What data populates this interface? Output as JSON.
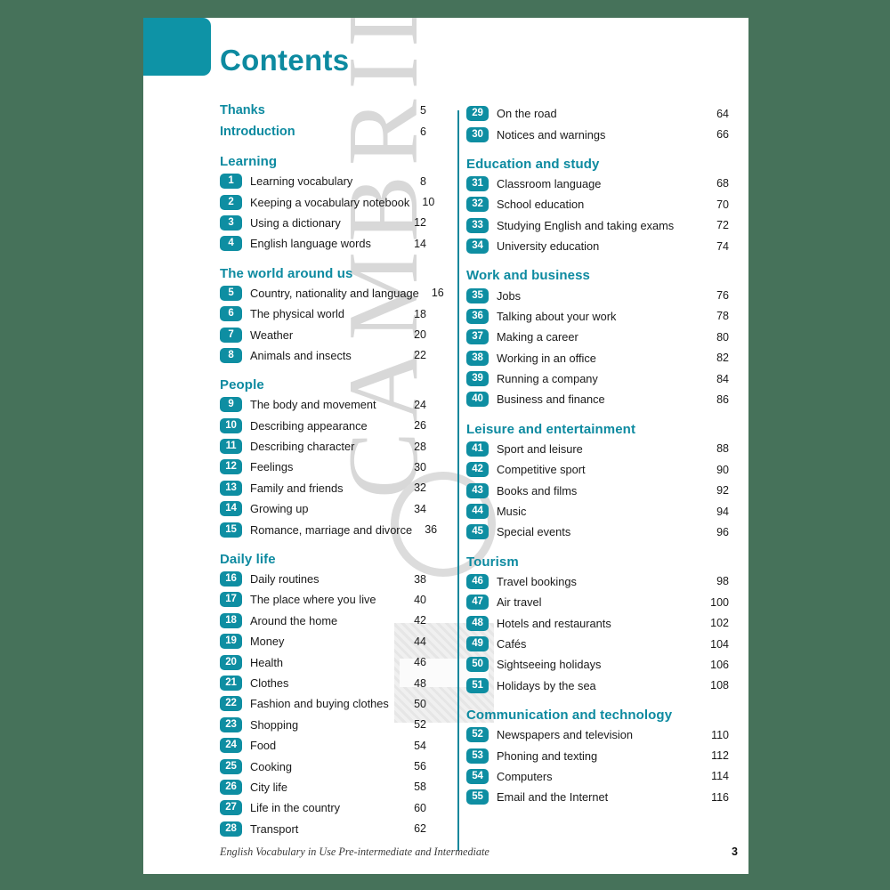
{
  "document": {
    "title": "Contents",
    "accent_color": "#0e93a6",
    "page_background": "#ffffff",
    "canvas_background": "#46725a",
    "watermark_text": "CAMBRIDGE"
  },
  "front_matter": [
    {
      "label": "Thanks",
      "page": "5"
    },
    {
      "label": "Introduction",
      "page": "6"
    }
  ],
  "left_column": [
    {
      "section": "Learning",
      "units": [
        {
          "num": "1",
          "title": "Learning vocabulary",
          "page": "8"
        },
        {
          "num": "2",
          "title": "Keeping a vocabulary notebook",
          "page": "10"
        },
        {
          "num": "3",
          "title": "Using a dictionary",
          "page": "12"
        },
        {
          "num": "4",
          "title": "English language words",
          "page": "14"
        }
      ]
    },
    {
      "section": "The world around us",
      "units": [
        {
          "num": "5",
          "title": "Country, nationality and language",
          "page": "16"
        },
        {
          "num": "6",
          "title": "The physical world",
          "page": "18"
        },
        {
          "num": "7",
          "title": "Weather",
          "page": "20"
        },
        {
          "num": "8",
          "title": "Animals and insects",
          "page": "22"
        }
      ]
    },
    {
      "section": "People",
      "units": [
        {
          "num": "9",
          "title": "The body and movement",
          "page": "24"
        },
        {
          "num": "10",
          "title": "Describing appearance",
          "page": "26"
        },
        {
          "num": "11",
          "title": "Describing character",
          "page": "28"
        },
        {
          "num": "12",
          "title": "Feelings",
          "page": "30"
        },
        {
          "num": "13",
          "title": "Family and friends",
          "page": "32"
        },
        {
          "num": "14",
          "title": "Growing up",
          "page": "34"
        },
        {
          "num": "15",
          "title": "Romance, marriage and divorce",
          "page": "36"
        }
      ]
    },
    {
      "section": "Daily life",
      "units": [
        {
          "num": "16",
          "title": "Daily routines",
          "page": "38"
        },
        {
          "num": "17",
          "title": "The place where you live",
          "page": "40"
        },
        {
          "num": "18",
          "title": "Around the home",
          "page": "42"
        },
        {
          "num": "19",
          "title": "Money",
          "page": "44"
        },
        {
          "num": "20",
          "title": "Health",
          "page": "46"
        },
        {
          "num": "21",
          "title": "Clothes",
          "page": "48"
        },
        {
          "num": "22",
          "title": "Fashion and buying clothes",
          "page": "50"
        },
        {
          "num": "23",
          "title": "Shopping",
          "page": "52"
        },
        {
          "num": "24",
          "title": "Food",
          "page": "54"
        },
        {
          "num": "25",
          "title": "Cooking",
          "page": "56"
        },
        {
          "num": "26",
          "title": "City life",
          "page": "58"
        },
        {
          "num": "27",
          "title": "Life in the country",
          "page": "60"
        },
        {
          "num": "28",
          "title": "Transport",
          "page": "62"
        }
      ]
    }
  ],
  "right_column": [
    {
      "section": "",
      "units": [
        {
          "num": "29",
          "title": "On the road",
          "page": "64"
        },
        {
          "num": "30",
          "title": "Notices and warnings",
          "page": "66"
        }
      ]
    },
    {
      "section": "Education and study",
      "units": [
        {
          "num": "31",
          "title": "Classroom language",
          "page": "68"
        },
        {
          "num": "32",
          "title": "School education",
          "page": "70"
        },
        {
          "num": "33",
          "title": "Studying English and taking exams",
          "page": "72"
        },
        {
          "num": "34",
          "title": "University education",
          "page": "74"
        }
      ]
    },
    {
      "section": "Work and business",
      "units": [
        {
          "num": "35",
          "title": "Jobs",
          "page": "76"
        },
        {
          "num": "36",
          "title": "Talking about your work",
          "page": "78"
        },
        {
          "num": "37",
          "title": "Making a career",
          "page": "80"
        },
        {
          "num": "38",
          "title": "Working in an office",
          "page": "82"
        },
        {
          "num": "39",
          "title": "Running a company",
          "page": "84"
        },
        {
          "num": "40",
          "title": "Business and finance",
          "page": "86"
        }
      ]
    },
    {
      "section": "Leisure and entertainment",
      "units": [
        {
          "num": "41",
          "title": "Sport and leisure",
          "page": "88"
        },
        {
          "num": "42",
          "title": "Competitive sport",
          "page": "90"
        },
        {
          "num": "43",
          "title": "Books and films",
          "page": "92"
        },
        {
          "num": "44",
          "title": "Music",
          "page": "94"
        },
        {
          "num": "45",
          "title": "Special events",
          "page": "96"
        }
      ]
    },
    {
      "section": "Tourism",
      "units": [
        {
          "num": "46",
          "title": "Travel bookings",
          "page": "98"
        },
        {
          "num": "47",
          "title": "Air travel",
          "page": "100"
        },
        {
          "num": "48",
          "title": "Hotels and restaurants",
          "page": "102"
        },
        {
          "num": "49",
          "title": "Cafés",
          "page": "104"
        },
        {
          "num": "50",
          "title": "Sightseeing holidays",
          "page": "106"
        },
        {
          "num": "51",
          "title": "Holidays by the sea",
          "page": "108"
        }
      ]
    },
    {
      "section": "Communication and technology",
      "units": [
        {
          "num": "52",
          "title": "Newspapers and television",
          "page": "110"
        },
        {
          "num": "53",
          "title": "Phoning and texting",
          "page": "112"
        },
        {
          "num": "54",
          "title": "Computers",
          "page": "114"
        },
        {
          "num": "55",
          "title": "Email and the Internet",
          "page": "116"
        }
      ]
    }
  ],
  "footer": {
    "book_title": "English Vocabulary in Use Pre-intermediate and Intermediate",
    "folio": "3"
  }
}
